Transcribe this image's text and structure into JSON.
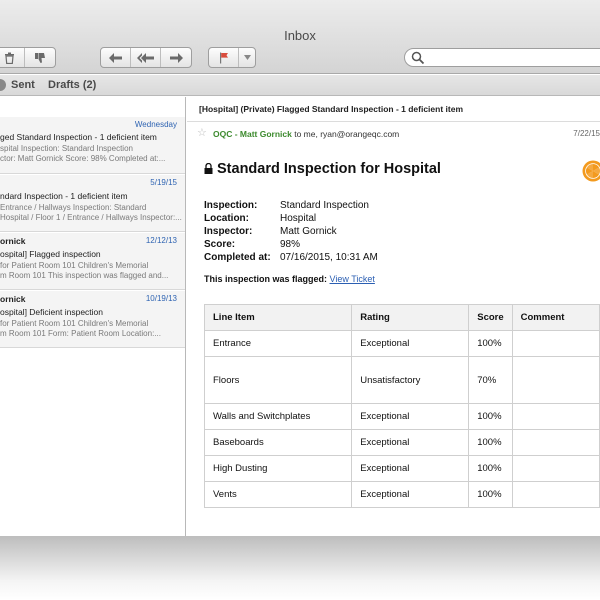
{
  "window": {
    "title": "Inbox"
  },
  "toolbar": {
    "delete_icon": "trash-icon",
    "junk_icon": "thumbs-down-icon",
    "reply_icon": "reply-arrow-icon",
    "reply_all_icon": "reply-all-arrow-icon",
    "forward_icon": "forward-arrow-icon",
    "flag_icon": "flag-icon",
    "flag_menu_icon": "chevron-down-icon",
    "search_icon": "magnifier-icon"
  },
  "mailboxes": {
    "sent": "Sent",
    "drafts": "Drafts (2)"
  },
  "messages": [
    {
      "from": "",
      "date": "Wednesday",
      "subject": "ged Standard Inspection - 1 deficient item",
      "preview1": "spital Inspection: Standard Inspection",
      "preview2": "ctor: Matt Gornick Score: 98% Completed at:..."
    },
    {
      "from": "",
      "date": "5/19/15",
      "subject": "ndard Inspection - 1 deficient item",
      "preview1": "Entrance / Hallways Inspection: Standard",
      "preview2": "Hospital / Floor 1 / Entrance / Hallways Inspector:..."
    },
    {
      "from": "ornick",
      "date": "12/12/13",
      "subject": "ospital] Flagged inspection",
      "preview1": "for Patient Room 101 Children's Memorial",
      "preview2": "m Room 101 This inspection was flagged and..."
    },
    {
      "from": "ornick",
      "date": "10/19/13",
      "subject": "ospital] Deficient inspection",
      "preview1": "for Patient Room 101 Children's Memorial",
      "preview2": "m Room 101 Form: Patient Room Location:..."
    }
  ],
  "view": {
    "subject": "[Hospital] (Private) Flagged Standard Inspection - 1 deficient item",
    "sender": "OQC - Matt Gornick",
    "recipients": " to me, ryan@orangeqc.com",
    "date": "7/22/15",
    "heading": "Standard Inspection for Hospital",
    "details": [
      {
        "label": "Inspection:",
        "value": "Standard Inspection"
      },
      {
        "label": "Location:",
        "value": "Hospital"
      },
      {
        "label": "Inspector:",
        "value": "Matt Gornick"
      },
      {
        "label": "Score:",
        "value": "98%"
      },
      {
        "label": "Completed at:",
        "value": "07/16/2015, 10:31 AM"
      }
    ],
    "flagged_text": "This inspection was flagged: ",
    "flagged_link": "View Ticket",
    "table": {
      "headers": [
        "Line Item",
        "Rating",
        "Score",
        "Comment"
      ],
      "rows": [
        [
          "Entrance",
          "Exceptional",
          "100%",
          ""
        ],
        [
          "Floors",
          "Unsatisfactory",
          "70%",
          ""
        ],
        [
          "Walls and Switchplates",
          "Exceptional",
          "100%",
          ""
        ],
        [
          "Baseboards",
          "Exceptional",
          "100%",
          ""
        ],
        [
          "High Dusting",
          "Exceptional",
          "100%",
          ""
        ],
        [
          "Vents",
          "Exceptional",
          "100%",
          ""
        ]
      ]
    }
  },
  "colors": {
    "link": "#2b5fb3",
    "sender": "#3c8a2d",
    "date": "#2f64b2",
    "accent_orange": "#f39a1e"
  }
}
